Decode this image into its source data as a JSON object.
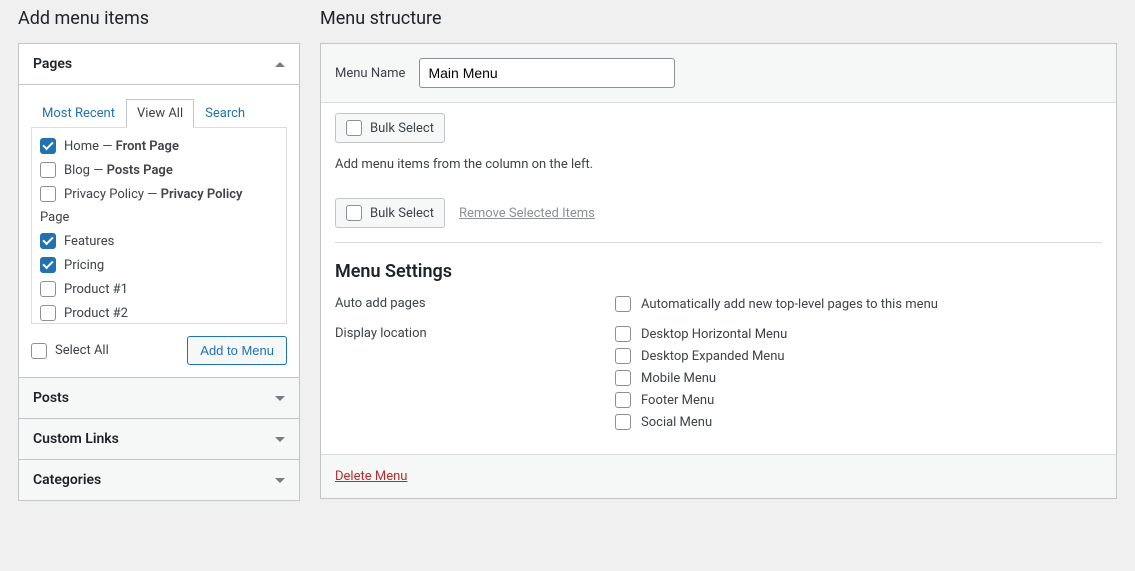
{
  "left": {
    "title": "Add menu items",
    "accordions": {
      "pages": {
        "label": "Pages",
        "tabs": {
          "recent": "Most Recent",
          "viewall": "View All",
          "search": "Search"
        },
        "items": [
          {
            "label": "Home",
            "suffix": " — ",
            "bold": "Front Page",
            "checked": true
          },
          {
            "label": "Blog",
            "suffix": " — ",
            "bold": "Posts Page",
            "checked": false
          },
          {
            "label": "Privacy Policy",
            "suffix": " — ",
            "bold": "Privacy Policy",
            "checked": false
          }
        ],
        "subhead": "Page",
        "sub_items": [
          {
            "label": "Features",
            "checked": true
          },
          {
            "label": "Pricing",
            "checked": true
          },
          {
            "label": "Product #1",
            "checked": false
          },
          {
            "label": "Product #2",
            "checked": false
          }
        ],
        "select_all": "Select All",
        "add_btn": "Add to Menu"
      },
      "posts": {
        "label": "Posts"
      },
      "custom": {
        "label": "Custom Links"
      },
      "categories": {
        "label": "Categories"
      }
    }
  },
  "right": {
    "title": "Menu structure",
    "menu_name_label": "Menu Name",
    "menu_name_value": "Main Menu",
    "bulk_select": "Bulk Select",
    "hint": "Add menu items from the column on the left.",
    "remove_selected": "Remove Selected Items",
    "settings_title": "Menu Settings",
    "auto_add_label": "Auto add pages",
    "auto_add_option": "Automatically add new top-level pages to this menu",
    "display_label": "Display location",
    "locations": [
      "Desktop Horizontal Menu",
      "Desktop Expanded Menu",
      "Mobile Menu",
      "Footer Menu",
      "Social Menu"
    ],
    "delete": "Delete Menu"
  }
}
